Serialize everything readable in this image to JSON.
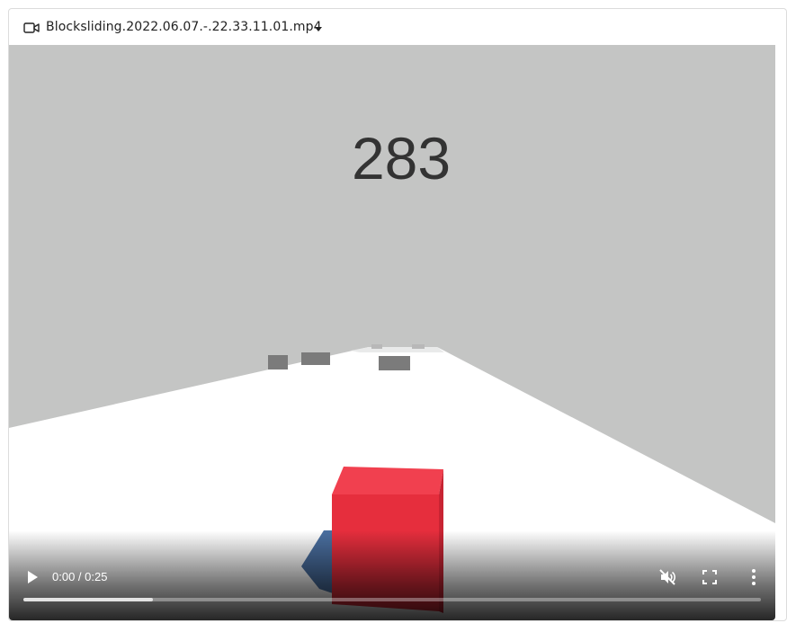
{
  "file": {
    "name": "Blocksliding.2022.06.07.-.22.33.11.01.mp4",
    "type_icon": "video-camera-icon",
    "menu_icon": "caret-down-icon"
  },
  "video": {
    "score": "283",
    "current_time": "0:00",
    "duration": "0:25",
    "time_text": "0:00 / 0:25",
    "buffered_fraction": 0.175,
    "muted": true
  },
  "colors": {
    "sky": "#c4c5c4",
    "road": "#ffffff",
    "player_block": "#e8303f",
    "obstacle": "#7b7b7b",
    "shadow": "#4a6fa0"
  },
  "icons": {
    "play": "play-icon",
    "mute": "volume-muted-icon",
    "fullscreen": "fullscreen-icon",
    "more": "more-vertical-icon"
  }
}
